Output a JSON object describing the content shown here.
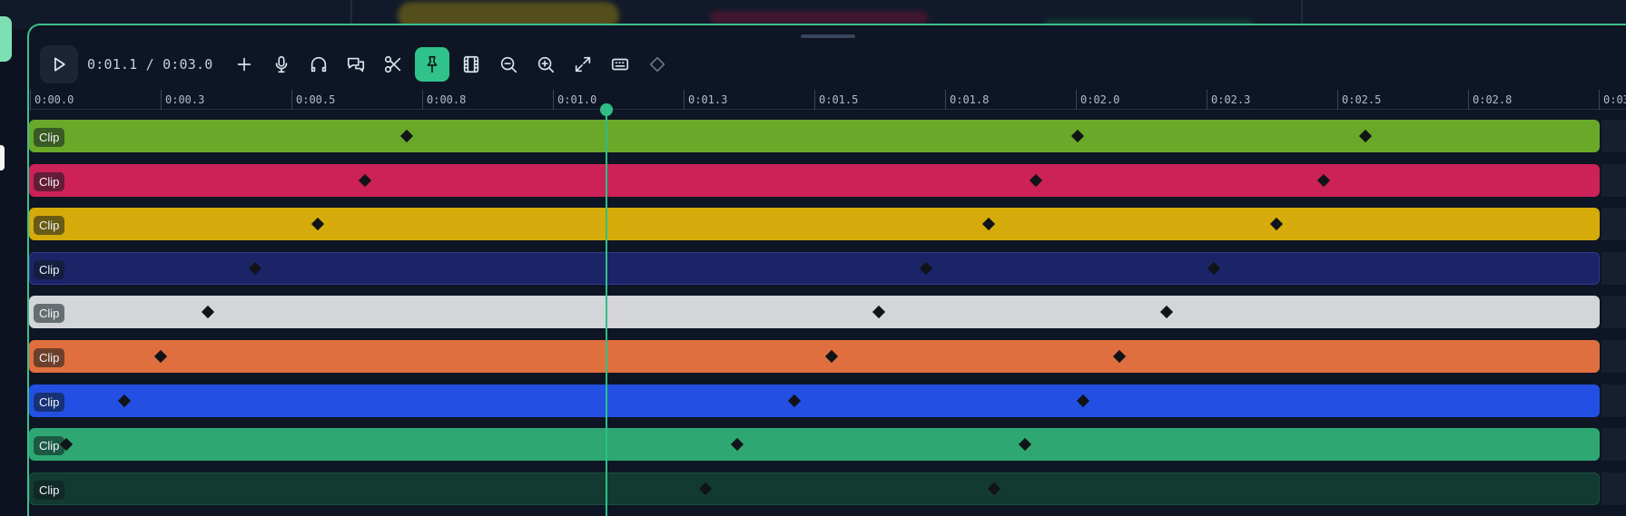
{
  "toolbar": {
    "timecode": "0:01.1 / 0:03.0",
    "buttons": [
      {
        "name": "add-button",
        "icon": "plus-icon",
        "active": false
      },
      {
        "name": "record-audio-button",
        "icon": "microphone-icon",
        "active": false
      },
      {
        "name": "voiceover-button",
        "icon": "headphones-icon",
        "active": false
      },
      {
        "name": "captions-button",
        "icon": "chat-bubbles-icon",
        "active": false
      },
      {
        "name": "split-button",
        "icon": "scissors-icon",
        "active": false
      },
      {
        "name": "snap-button",
        "icon": "pin-icon",
        "active": true
      },
      {
        "name": "filmstrip-button",
        "icon": "film-icon",
        "active": false
      },
      {
        "name": "zoom-out-button",
        "icon": "zoom-out-icon",
        "active": false
      },
      {
        "name": "zoom-in-button",
        "icon": "zoom-in-icon",
        "active": false
      },
      {
        "name": "fit-button",
        "icon": "expand-icon",
        "active": false
      },
      {
        "name": "shortcuts-button",
        "icon": "keyboard-icon",
        "active": false
      },
      {
        "name": "keyframe-button",
        "icon": "diamond-icon",
        "active": false,
        "dim": true
      }
    ]
  },
  "ruler": {
    "labels": [
      "0:00.0",
      "0:00.3",
      "0:00.5",
      "0:00.8",
      "0:01.0",
      "0:01.3",
      "0:01.5",
      "0:01.8",
      "0:02.0",
      "0:02.3",
      "0:02.5",
      "0:02.8",
      "0:03"
    ]
  },
  "playhead": {
    "time_seconds": 1.1
  },
  "duration_seconds": 3.0,
  "tracks": [
    {
      "label": "Clip",
      "color": "#6aa82a",
      "keyframes_seconds": [
        0.72,
        2.0,
        2.55
      ]
    },
    {
      "label": "Clip",
      "color": "#cc2257",
      "keyframes_seconds": [
        0.64,
        1.92,
        2.47
      ]
    },
    {
      "label": "Clip",
      "color": "#d4ab0a",
      "keyframes_seconds": [
        0.55,
        1.83,
        2.38
      ]
    },
    {
      "label": "Clip",
      "color": "#1c2468",
      "keyframes_seconds": [
        0.43,
        1.71,
        2.26
      ]
    },
    {
      "label": "Clip",
      "color": "#d3d5d8",
      "keyframes_seconds": [
        0.34,
        1.62,
        2.17
      ]
    },
    {
      "label": "Clip",
      "color": "#e06f3f",
      "keyframes_seconds": [
        0.25,
        1.53,
        2.08
      ]
    },
    {
      "label": "Clip",
      "color": "#2350e3",
      "keyframes_seconds": [
        0.18,
        1.46,
        2.01
      ]
    },
    {
      "label": "Clip",
      "color": "#2ea773",
      "keyframes_seconds": [
        0.07,
        1.35,
        1.9
      ]
    },
    {
      "label": "Clip",
      "color": "#123a31",
      "keyframes_seconds": [
        1.29,
        1.84
      ]
    }
  ]
}
